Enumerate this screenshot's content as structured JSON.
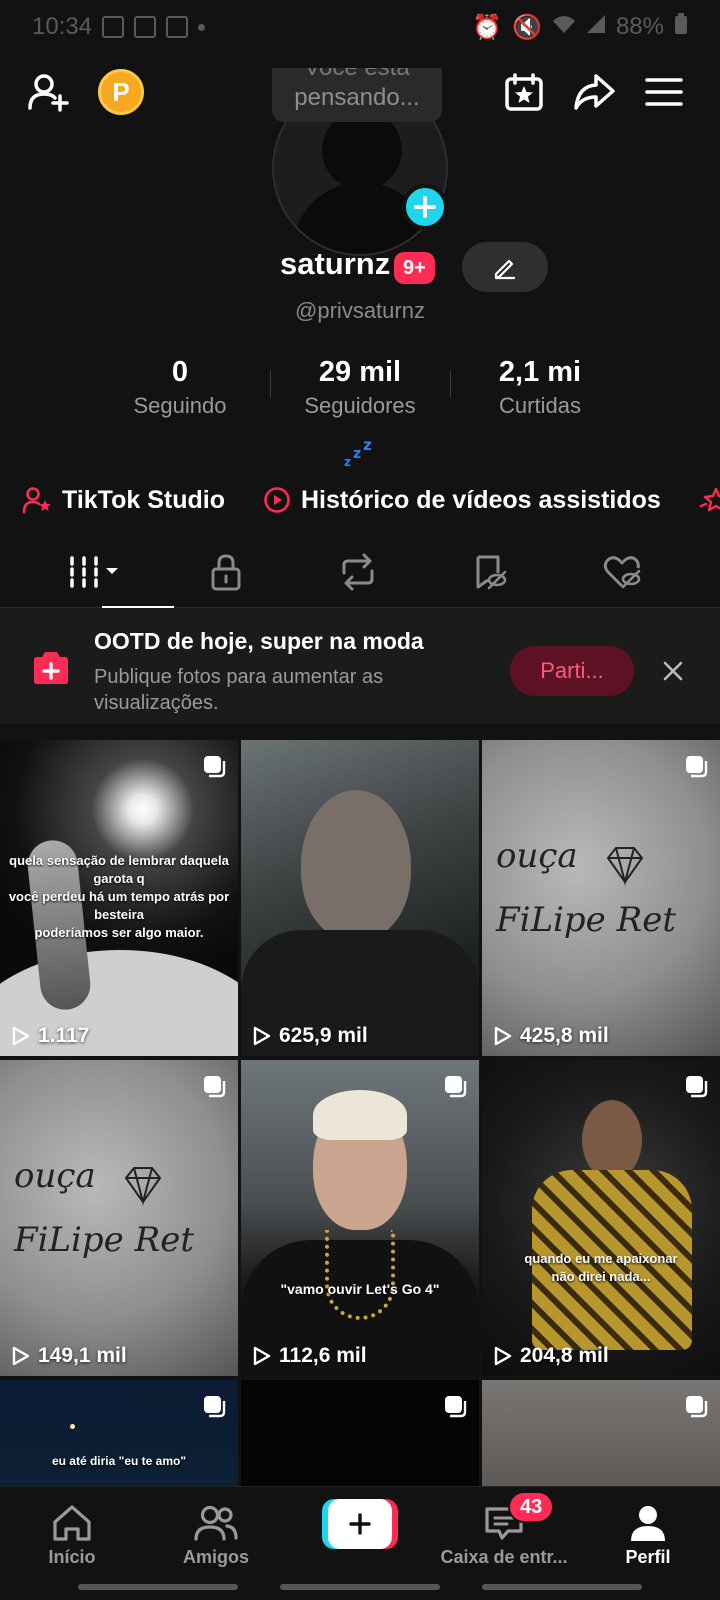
{
  "status_bar": {
    "time": "10:34",
    "battery": "88%"
  },
  "profile": {
    "thought_text": "pensando...",
    "thought_prev": "Você está",
    "username": "saturnz",
    "notif_badge": "9+",
    "handle": "@privsaturnz"
  },
  "stats": [
    {
      "num": "0",
      "label": "Seguindo"
    },
    {
      "num": "29 mil",
      "label": "Seguidores"
    },
    {
      "num": "2,1 mi",
      "label": "Curtidas"
    }
  ],
  "links": {
    "studio": "TikTok Studio",
    "history": "Histórico de vídeos assistidos"
  },
  "promo": {
    "title": "OOTD de hoje, super na moda",
    "subtitle": "Publique fotos para aumentar as visualizações.",
    "button": "Parti..."
  },
  "videos": [
    {
      "views": "1.117",
      "caption": "quela sensação de lembrar daquela garota q\nvocê perdeu há um tempo atrás por besteira\npoderíamos ser algo maior."
    },
    {
      "views": "625,9 mil",
      "caption": ""
    },
    {
      "views": "425,8 mil",
      "caption": ""
    },
    {
      "views": "149,1 mil",
      "caption": ""
    },
    {
      "views": "112,6 mil",
      "caption": "\"vamo ouvir Let's Go 4\""
    },
    {
      "views": "204,8 mil",
      "caption": "quando eu me apaixonar\nnão direi nada..."
    },
    {
      "views": "",
      "caption": "eu até diria \"eu te amo\""
    },
    {
      "views": "",
      "caption": ""
    },
    {
      "views": "",
      "caption": ""
    }
  ],
  "scrawl": {
    "line1": "ouça",
    "line2": "FiLipe Ret"
  },
  "bottom_nav": {
    "home": "Início",
    "friends": "Amigos",
    "inbox": "Caixa de entr...",
    "inbox_badge": "43",
    "profile": "Perfil"
  },
  "colors": {
    "accent": "#fe2c55",
    "cyan": "#20d5ec",
    "background": "#121212"
  }
}
